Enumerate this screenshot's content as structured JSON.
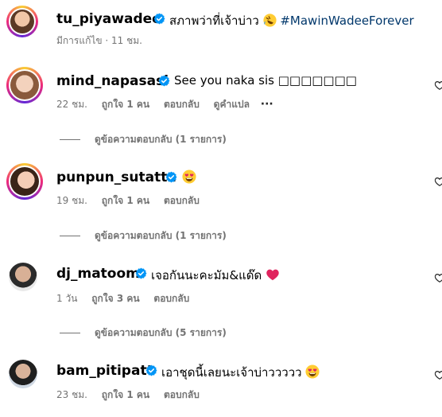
{
  "caption": {
    "username": "tu_piyawadee",
    "text": "สภาพว่าที่เจ้าบ่าว",
    "hashtag": "#MawinWadeeForever",
    "meta": "มีการแก้ไข · 11 ชม."
  },
  "comments": [
    {
      "username": "mind_napasasi",
      "text": "See you naka sis ",
      "text_tail": "□□□□□□□",
      "time": "22 ชม.",
      "likes": "ถูกใจ 1 คน",
      "reply": "ตอบกลับ",
      "translate": "ดูคำแปล",
      "more": "···",
      "view_replies": "ดูข้อความตอบกลับ (1 รายการ)"
    },
    {
      "username": "punpun_sutatta",
      "time": "19 ชม.",
      "likes": "ถูกใจ 1 คน",
      "reply": "ตอบกลับ",
      "view_replies": "ดูข้อความตอบกลับ (1 รายการ)"
    },
    {
      "username": "dj_matoom",
      "text": "เจอกันนะคะมัม&แด๊ด",
      "time": "1 วัน",
      "likes": "ถูกใจ 3 คน",
      "reply": "ตอบกลับ",
      "view_replies": "ดูข้อความตอบกลับ (5 รายการ)"
    },
    {
      "username": "bam_pitipatt",
      "text": "เอาชุดนี้เลยนะเจ้าบ่าววววว",
      "time": "23 ชม.",
      "likes": "ถูกใจ 1 คน",
      "reply": "ตอบกลับ"
    }
  ],
  "icons": {
    "verified": "verified-badge-icon",
    "heart": "heart-outline-icon",
    "emoji_rofl": "rolling-laughing-emoji-icon",
    "emoji_hearteyes": "heart-eyes-emoji-icon",
    "emoji_redheart": "red-heart-emoji-icon"
  },
  "colors": {
    "verified": "#0095f6",
    "hashtag": "#00376b",
    "meta": "#737373"
  }
}
